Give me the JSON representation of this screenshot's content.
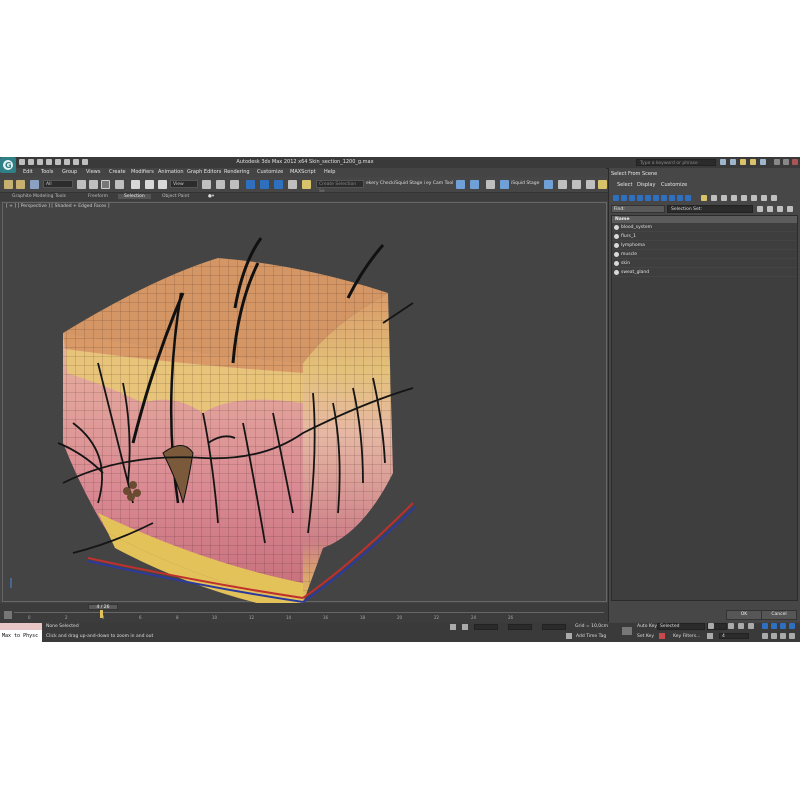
{
  "app": {
    "title": "Autodesk 3ds Max  2012 x64     Skin_section_1200_g.max",
    "search_placeholder": "Type a keyword or phrase",
    "menu": [
      "Edit",
      "Tools",
      "Group",
      "Views",
      "Create",
      "Modifiers",
      "Animation",
      "Graph Editors",
      "Rendering",
      "Customize",
      "MAXScript",
      "Help"
    ]
  },
  "toolbar": {
    "selection_filter": "All",
    "reference_coord": "View",
    "named_selection_placeholder": "Create Selection Se",
    "text_items": [
      "ekery Check",
      "iSquid Stage i",
      "ey Cam Tool",
      "iSquid Stage"
    ]
  },
  "ribbon": {
    "tabs": [
      "Graphite Modeling Tools",
      "Freeform",
      "Selection",
      "Object Paint"
    ]
  },
  "viewport": {
    "label": "[ + ] [ Perspective ] [ Shaded + Edged Faces ]"
  },
  "timeline": {
    "frame_counter": "4 / 26",
    "ticks": [
      "0",
      "2",
      "4",
      "6",
      "8",
      "10",
      "12",
      "14",
      "16",
      "18",
      "20",
      "22",
      "24",
      "26"
    ]
  },
  "status": {
    "maxscript_text": "Max to Physc",
    "selection": "None Selected",
    "prompt": "Click and drag up-and-down to zoom in and out",
    "grid": "Grid = 10,0cm",
    "auto_key": "Auto Key",
    "auto_key_value": "Selected",
    "set_key": "Set Key",
    "key_filters": "Key Filters...",
    "add_time_tag": "Add Time Tag",
    "frame_value": "4"
  },
  "dialog": {
    "title": "Select From Scene",
    "menu": [
      "Select",
      "Display",
      "Customize"
    ],
    "find_label": "Find:",
    "selection_set_label": "Selection Set:",
    "column_header": "Name",
    "items": [
      "blood_system",
      "flurs_1",
      "lymphoma",
      "muscle",
      "skin",
      "sweat_gland"
    ],
    "ok_label": "OK",
    "cancel_label": "Cancel"
  },
  "colors": {
    "ui_bg": "#444444",
    "accent_blue": "#2f6fbf",
    "skin_top": "#d69a62",
    "dermis": "#e0a0a8",
    "fat": "#e3c25a"
  }
}
